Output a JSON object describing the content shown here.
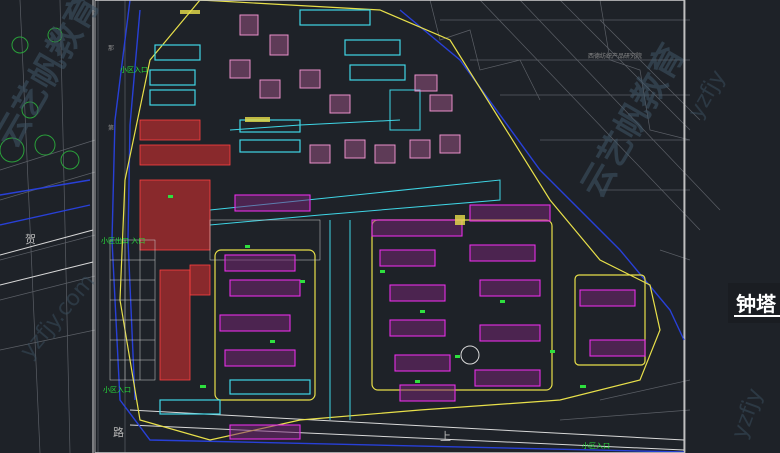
{
  "title": "钟塔",
  "labels": {
    "research_institute": "西德纺织产品研究院",
    "entrance_1": "小区出口 入口",
    "entrance_2": "小区入口",
    "entrance_3": "小区入口",
    "entrance_4": "小区入口",
    "road_1": "贺",
    "road_2": "路",
    "road_3": "上",
    "road_4": "那",
    "road_5": "第"
  },
  "watermarks": [
    "云艺帆教育",
    "yzfjy.com",
    "yzfjy"
  ],
  "colors": {
    "background": "#1e2228",
    "building_magenta": "#e62ee6",
    "building_cyan": "#3fd6e6",
    "building_red": "#e23030",
    "outline_yellow": "#e8e04a",
    "outline_blue": "#2840d8",
    "road_white": "#d8d8d8",
    "green": "#2ee03e"
  }
}
